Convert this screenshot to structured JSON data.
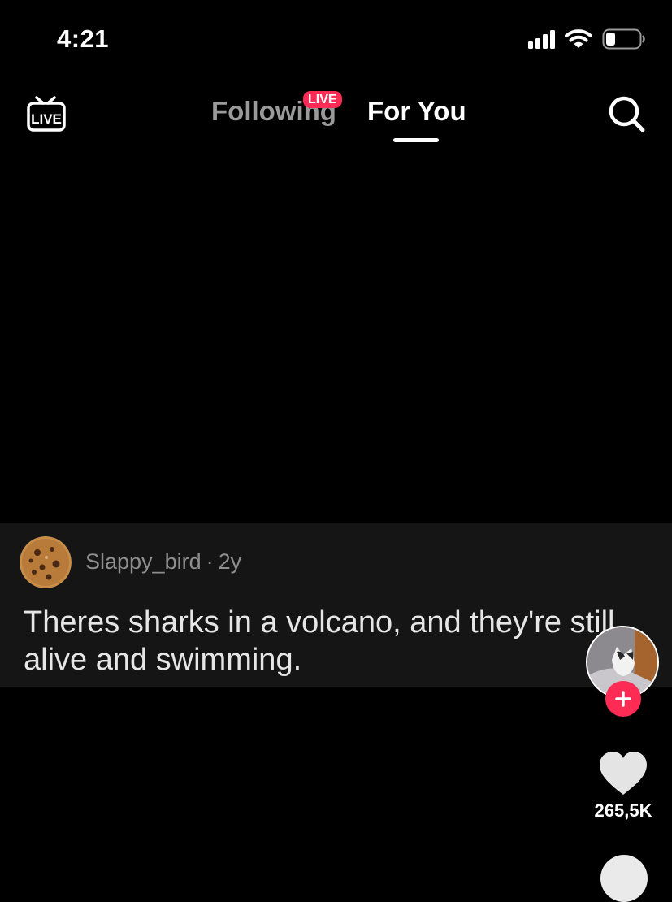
{
  "status_bar": {
    "time": "4:21",
    "icons": [
      "signal-icon",
      "wifi-icon",
      "battery-icon"
    ]
  },
  "nav": {
    "live_icon": "live-tv-icon",
    "following_label": "Following",
    "live_badge": "LIVE",
    "foryou_label": "For You",
    "search_icon": "search-icon"
  },
  "comment": {
    "username": "Slappy_bird",
    "separator": "·",
    "age": "2y",
    "text": "Theres sharks in a volcano, and they're still alive and swimming."
  },
  "actions": {
    "like_count": "265,5K"
  },
  "colors": {
    "background": "#000000",
    "panel": "#151515",
    "accent": "#fe2c55",
    "muted_text": "#8e8e8e"
  }
}
